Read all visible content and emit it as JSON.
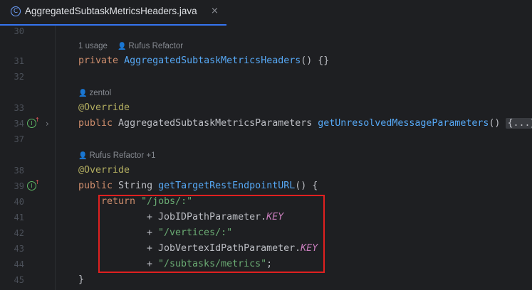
{
  "tab": {
    "icon_letter": "C",
    "title": "AggregatedSubtaskMetricsHeaders.java",
    "close_glyph": "×"
  },
  "hints": {
    "h1": {
      "usage": "1 usage",
      "author": "Rufus Refactor"
    },
    "h2": {
      "author": "zentol"
    },
    "h3": {
      "author": "Rufus Refactor +1"
    }
  },
  "lines": [
    {
      "n": "30"
    },
    {
      "n": "31"
    },
    {
      "n": "32"
    },
    {
      "n": "33"
    },
    {
      "n": "34"
    },
    {
      "n": "37"
    },
    {
      "n": "38"
    },
    {
      "n": "39"
    },
    {
      "n": "40"
    },
    {
      "n": "41"
    },
    {
      "n": "42"
    },
    {
      "n": "43"
    },
    {
      "n": "44"
    },
    {
      "n": "45"
    }
  ],
  "code": {
    "l31": {
      "kw": "private",
      "fn": "AggregatedSubtaskMetricsHeaders",
      "rest": "() {}"
    },
    "l33": {
      "ann": "@Override"
    },
    "l34": {
      "kw": "public",
      "type": " AggregatedSubtaskMetricsParameters ",
      "fn": "getUnresolvedMessageParameters",
      "rest": "() ",
      "fold": "{...}"
    },
    "l38": {
      "ann": "@Override"
    },
    "l39": {
      "kw": "public",
      "type": " String ",
      "fn": "getTargetRestEndpointURL",
      "rest": "() {"
    },
    "l40": {
      "kw": "return",
      "str": "\"/jobs/:\""
    },
    "l41": {
      "op": "+ JobIDPathParameter.",
      "const": "KEY"
    },
    "l42": {
      "op": "+ ",
      "str": "\"/vertices/:\""
    },
    "l43": {
      "op": "+ JobVertexIdPathParameter.",
      "const": "KEY"
    },
    "l44": {
      "op": "+ ",
      "str": "\"/subtasks/metrics\"",
      "end": ";"
    },
    "l45": {
      "rest": "}"
    }
  },
  "gutter": {
    "impl_icon": "I",
    "arrow": "↑",
    "fold_chevron": "›"
  },
  "colors": {
    "accent": "#3574f0",
    "highlight": "#e02020"
  }
}
